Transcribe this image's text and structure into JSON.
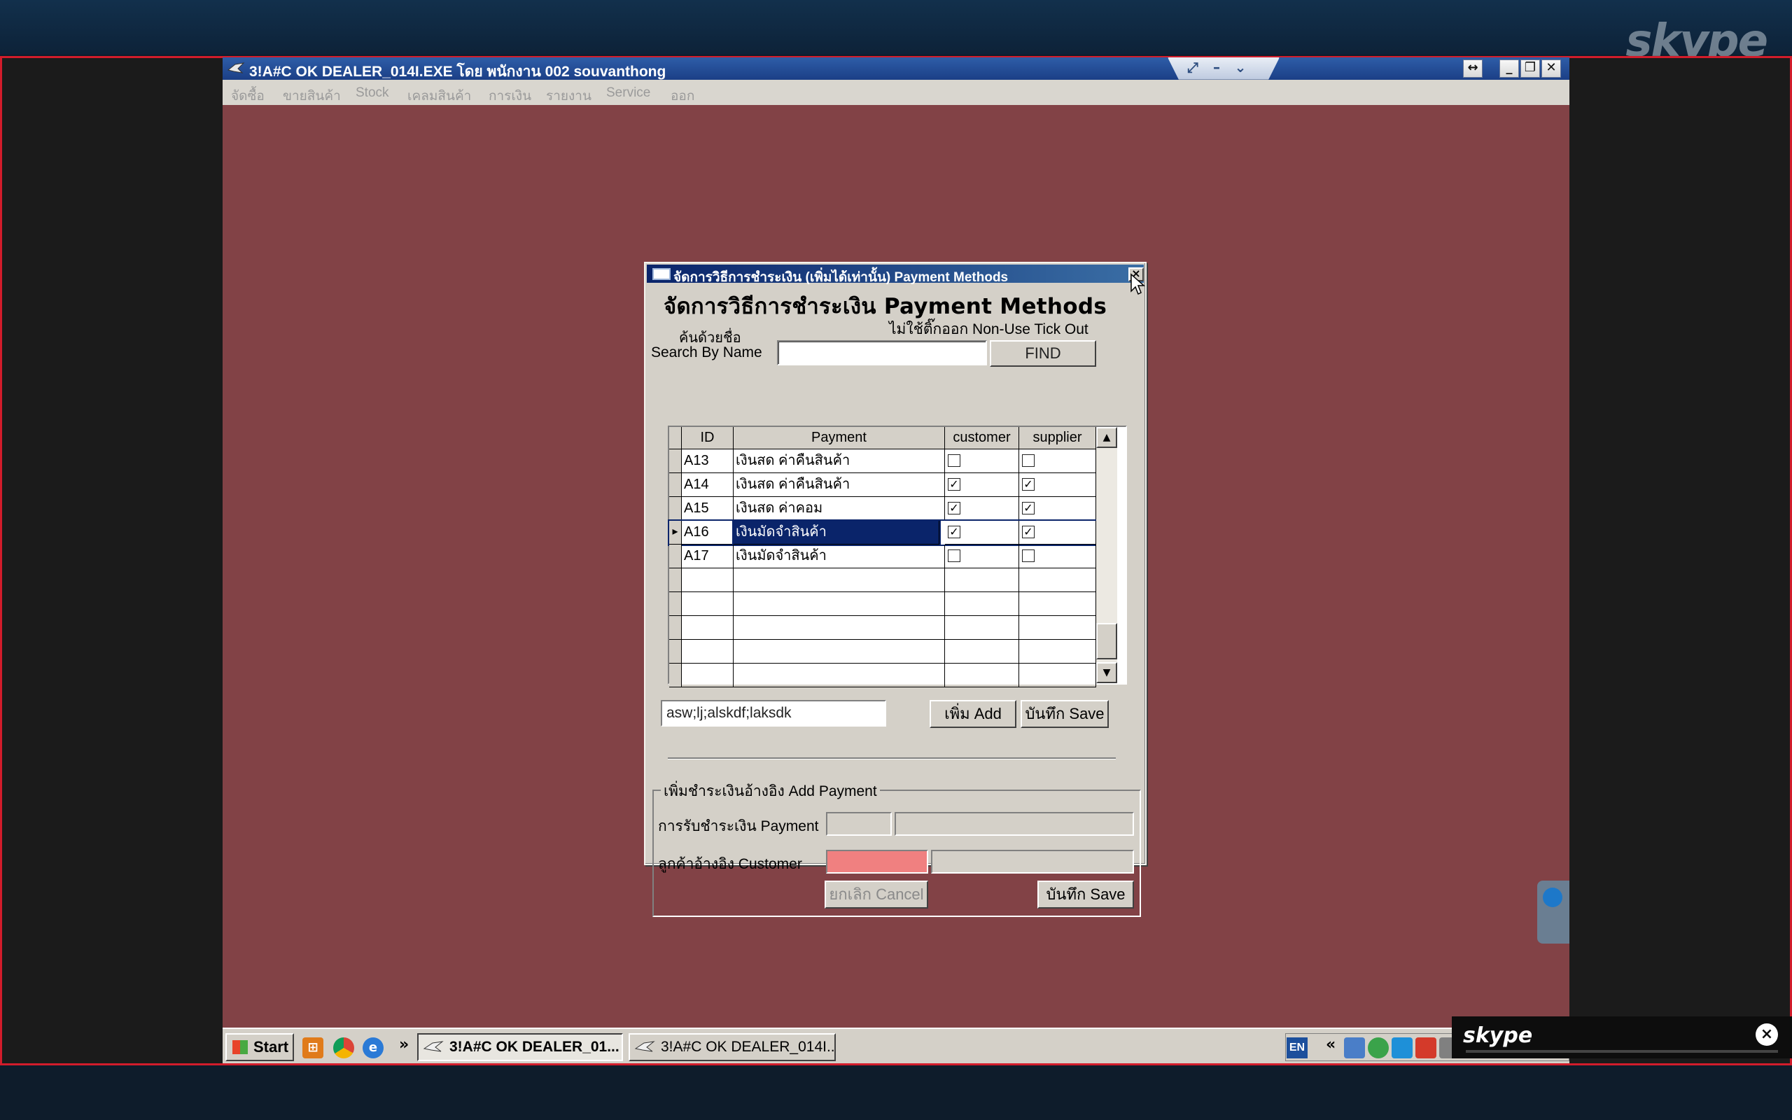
{
  "app": {
    "title": "3!A#C OK DEALER_014I.EXE โดย พนักงาน 002 souvanthong",
    "menu": [
      "จัดซื้อ",
      "ขายสินค้า",
      "Stock",
      "เคลมสินค้า",
      "การเงิน",
      "รายงาน",
      "Service",
      "ออก"
    ]
  },
  "dialog": {
    "title": "จัดการวิธีการชำระเงิน (เพิ่มได้เท่านั้น) Payment Methods",
    "heading": "จัดการวิธีการชำระเงิน Payment Methods",
    "nonuse_label": "ไม่ใช้ติ๊กออก Non-Use Tick Out",
    "search_label_th": "ค้นด้วยชื่อ",
    "search_label_en": "Search By Name",
    "search_value": "",
    "find_label": "FIND",
    "columns": [
      "ID",
      "Payment",
      "customer",
      "supplier"
    ],
    "rows": [
      {
        "id": "A13",
        "payment": "เงินสด ค่าคืนสินค้า",
        "customer": false,
        "supplier": false
      },
      {
        "id": "A14",
        "payment": "เงินสด ค่าคืนสินค้า",
        "customer": true,
        "supplier": true
      },
      {
        "id": "A15",
        "payment": "เงินสด ค่าคอม",
        "customer": true,
        "supplier": true
      },
      {
        "id": "A16",
        "payment": "เงินมัดจำสินค้า",
        "customer": true,
        "supplier": true,
        "selected": true
      },
      {
        "id": "A17",
        "payment": "เงินมัดจำสินค้า",
        "customer": false,
        "supplier": false
      }
    ],
    "new_name_value": "asw;lj;alskdf;laksdk",
    "add_label": "เพิ่ม Add",
    "save_label": "บันทึก Save",
    "group_legend": "เพิ่มชำระเงินอ้างอิง Add Payment",
    "payment_label": "การรับชำระเงิน Payment",
    "customer_label": "ลูกค้าอ้างอิง Customer",
    "cancel_label": "ยกเลิก Cancel",
    "group_save_label": "บันทึก Save",
    "customer_field_color": "#f08080"
  },
  "taskbar": {
    "start_label": "Start",
    "overflow": "»",
    "tasks": [
      "3!A#C OK DEALER_01...",
      "3!A#C OK DEALER_014I..."
    ],
    "lang": "EN",
    "tray_chevron": "«"
  },
  "skype": {
    "watermark": "skype",
    "popup_logo": "skype",
    "close_glyph": "×"
  }
}
